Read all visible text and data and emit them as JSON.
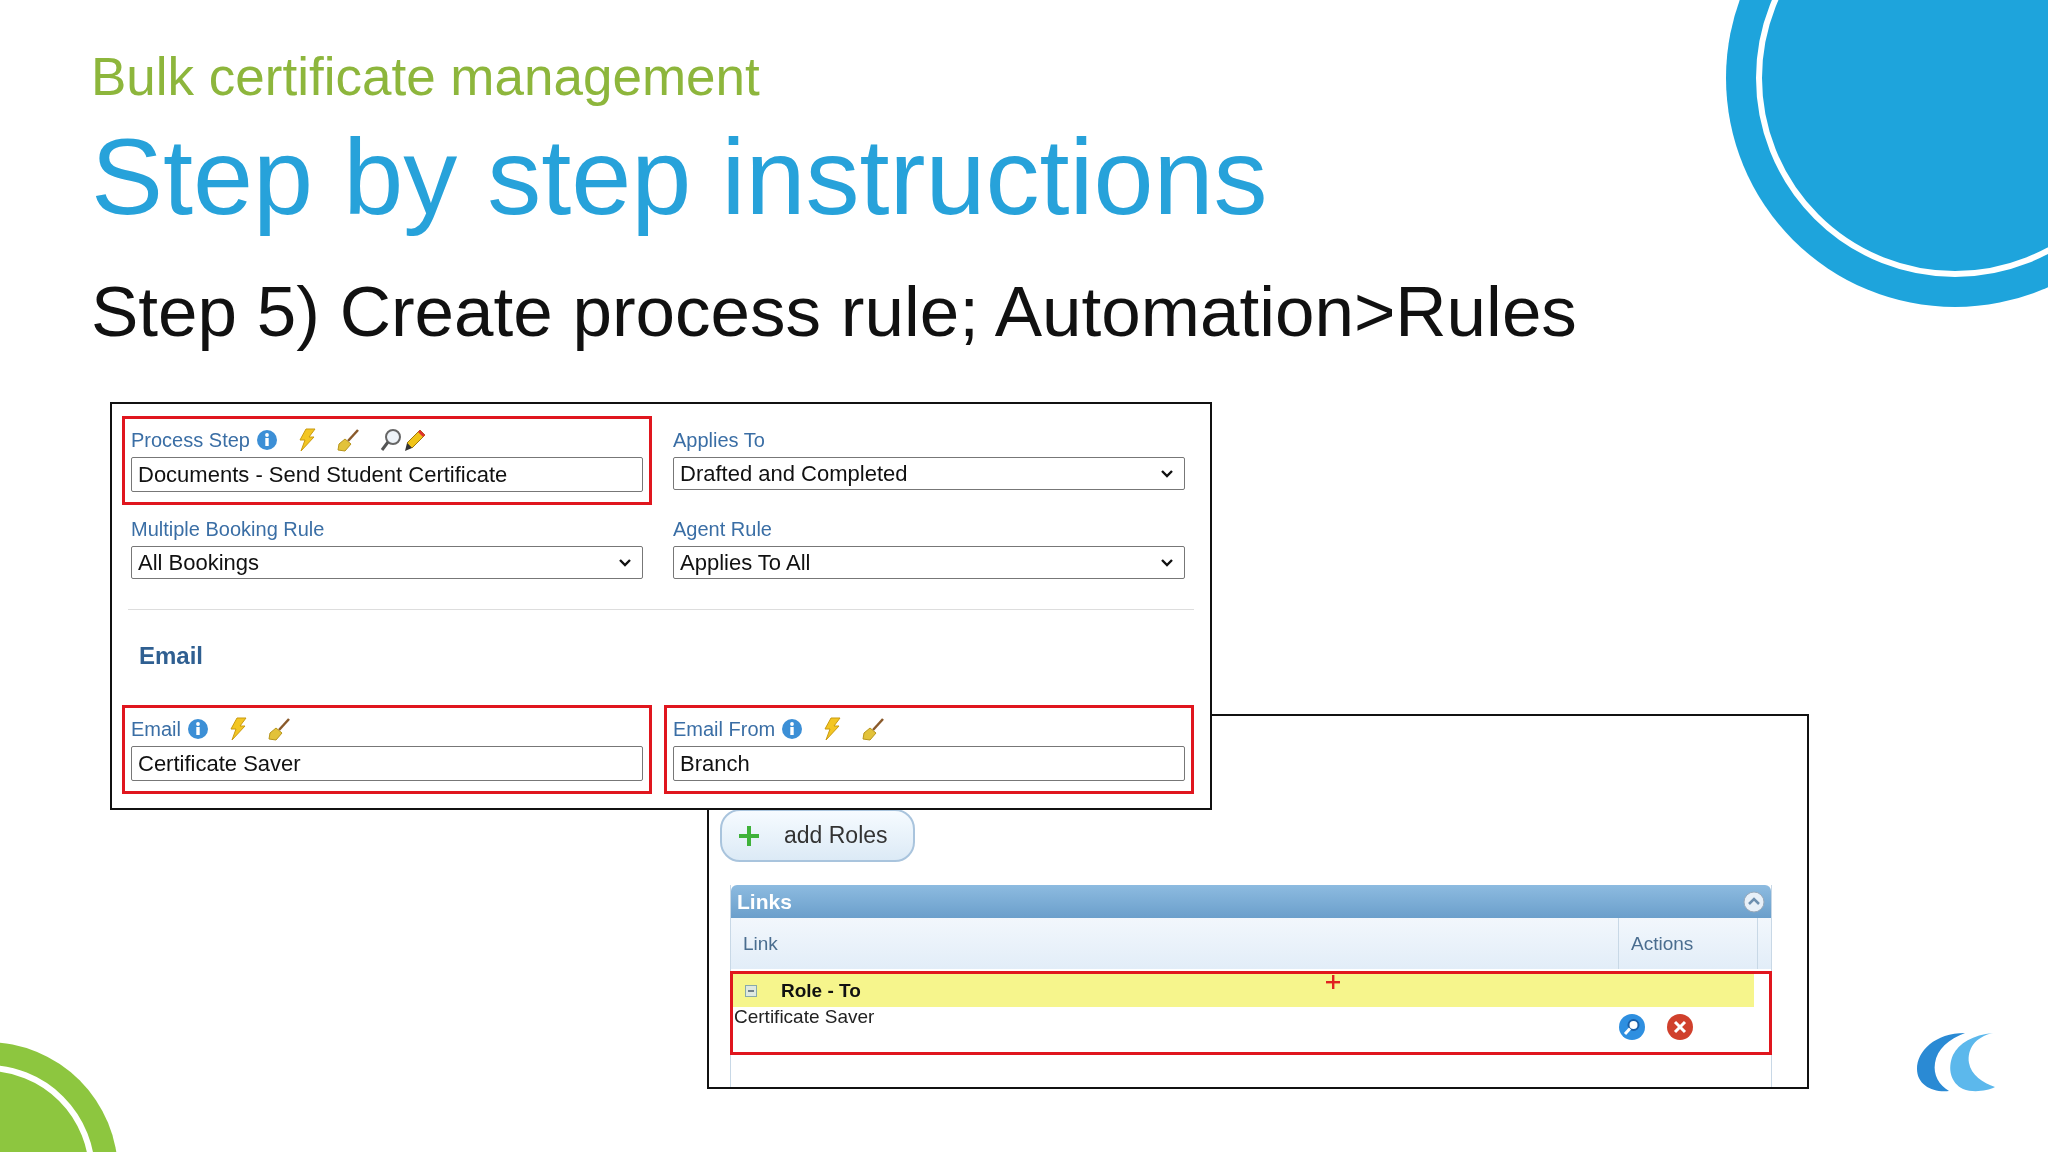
{
  "slide": {
    "subtitle": "Bulk certificate management",
    "title": "Step by step instructions",
    "step": "Step 5) Create process rule; Automation>Rules"
  },
  "rule_form": {
    "fields": [
      {
        "kind": "lookup",
        "label": "Process Step",
        "value": "Documents - Send Student Certificate",
        "highlighted": true
      },
      {
        "kind": "select",
        "label": "Applies To",
        "value": "Drafted and Completed",
        "highlighted": false
      },
      {
        "kind": "select",
        "label": "Multiple Booking Rule",
        "value": "All Bookings",
        "highlighted": false
      },
      {
        "kind": "select",
        "label": "Agent Rule",
        "value": "Applies To All",
        "highlighted": false
      }
    ],
    "section": "Email",
    "email_fields": [
      {
        "kind": "text",
        "label": "Email",
        "value": "Certificate Saver",
        "highlighted": true
      },
      {
        "kind": "text",
        "label": "Email From",
        "value": "Branch",
        "highlighted": true
      }
    ]
  },
  "links_panel": {
    "add_button": "add Roles",
    "table": {
      "title": "Links",
      "columns": [
        "Link",
        "Actions"
      ],
      "groups": [
        {
          "label": "Role - To",
          "expanded": true,
          "highlighted": true,
          "rows": [
            {
              "link": "Certificate Saver"
            }
          ]
        }
      ]
    }
  }
}
